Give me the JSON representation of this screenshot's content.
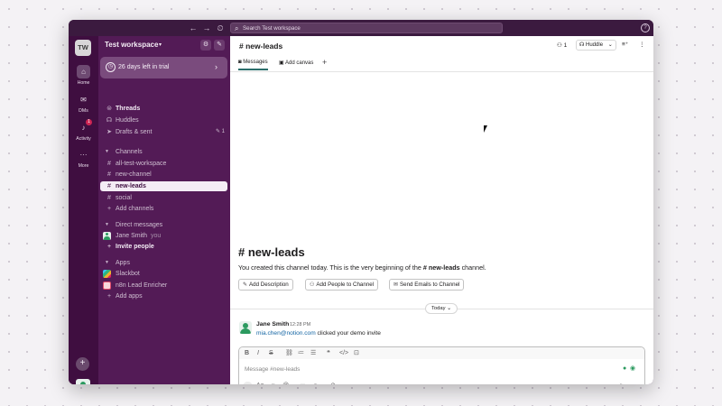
{
  "topbar": {
    "back_icon": "←",
    "forward_icon": "→",
    "history_icon": "⏲",
    "search_icon": "⌕",
    "search_placeholder": "Search Test workspace",
    "help_icon": "?"
  },
  "rail": {
    "workspace_initials": "TW",
    "home_label": "Home",
    "dms_label": "DMs",
    "activity_label": "Activity",
    "activity_badge": "1",
    "more_label": "More",
    "home_icon": "⌂",
    "dms_icon": "✉",
    "activity_icon": "♪",
    "more_icon": "···",
    "add_icon": "+"
  },
  "sidebar": {
    "workspace_name": "Test workspace",
    "caret": "▾",
    "settings_icon": "⚙",
    "compose_icon": "✎",
    "trial_text": "26 days left in trial",
    "trial_chevron": "›",
    "threads": "Threads",
    "huddles": "Huddles",
    "drafts": "Drafts & sent",
    "drafts_count": "1",
    "channels_header": "Channels",
    "channels": [
      "all-test-workspace",
      "new-channel",
      "new-leads",
      "social"
    ],
    "add_channels": "Add channels",
    "dm_header": "Direct messages",
    "dm_user": "Jane Smith",
    "dm_you": "you",
    "invite": "Invite people",
    "apps_header": "Apps",
    "apps": [
      "Slackbot",
      "n8n Lead Enricher"
    ],
    "add_apps": "Add apps"
  },
  "main": {
    "channel_title": "# new-leads",
    "member_count": "1",
    "huddle_label": "Huddle",
    "tabs": {
      "messages": "Messages",
      "add_canvas": "Add canvas",
      "plus": "+"
    },
    "intro_title": "# new-leads",
    "intro_desc_pre": "You created this channel today. This is the very beginning of the ",
    "intro_desc_channel": "# new-leads",
    "intro_desc_post": " channel.",
    "buttons": {
      "add_description": "Add Description",
      "add_people": "Add People to Channel",
      "send_emails": "Send Emails to Channel"
    },
    "today_label": "Today ⌄",
    "message": {
      "author": "Jane Smith",
      "time": "12:28 PM",
      "link": "mia.chen@notion.com",
      "text": " clicked your demo invite"
    },
    "composer_placeholder": "Message #new-leads"
  }
}
